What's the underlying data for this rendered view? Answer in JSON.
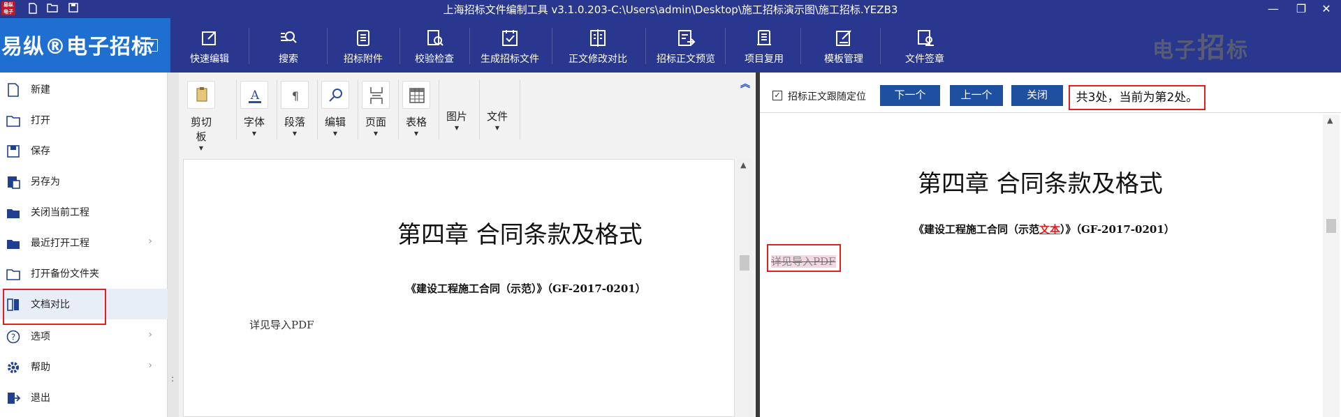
{
  "window": {
    "title": "上海招标文件编制工具 v3.1.0.203-C:\\Users\\admin\\Desktop\\施工招标演示图\\施工招标.YEZB3",
    "app_icon_text": "易纵 电子招标"
  },
  "brand": {
    "name": "易纵®电子招标"
  },
  "ribbon": {
    "tools": [
      {
        "label": "快速编辑",
        "icon": "quick-edit-icon"
      },
      {
        "label": "搜索",
        "icon": "search-icon"
      },
      {
        "label": "招标附件",
        "icon": "attachment-icon"
      },
      {
        "label": "校验检查",
        "icon": "check-icon"
      },
      {
        "label": "生成招标文件",
        "icon": "generate-file-icon"
      },
      {
        "label": "正文修改对比",
        "icon": "compare-icon"
      },
      {
        "label": "招标正文预览",
        "icon": "preview-icon"
      },
      {
        "label": "项目复用",
        "icon": "reuse-icon"
      },
      {
        "label": "模板管理",
        "icon": "template-icon"
      },
      {
        "label": "文件签章",
        "icon": "signature-icon"
      }
    ],
    "watermark_a": "电子",
    "watermark_b": "招",
    "watermark_c": "标"
  },
  "sidebar": {
    "items": [
      {
        "label": "新建",
        "icon": "new-file-icon"
      },
      {
        "label": "打开",
        "icon": "open-folder-icon"
      },
      {
        "label": "保存",
        "icon": "save-icon"
      },
      {
        "label": "另存为",
        "icon": "save-as-icon"
      },
      {
        "label": "关闭当前工程",
        "icon": "close-project-icon"
      },
      {
        "label": "最近打开工程",
        "icon": "recent-folder-icon",
        "arrow": "›"
      },
      {
        "label": "打开备份文件夹",
        "icon": "backup-folder-icon"
      },
      {
        "label": "文档对比",
        "icon": "doc-compare-icon"
      },
      {
        "label": "选项",
        "icon": "help-circle-icon",
        "arrow": "›"
      },
      {
        "label": "帮助",
        "icon": "gear-icon",
        "arrow": "›"
      },
      {
        "label": "退出",
        "icon": "exit-icon"
      }
    ]
  },
  "editor_toolbar": {
    "groups": [
      {
        "label": "剪切板"
      },
      {
        "label": "字体"
      },
      {
        "label": "段落"
      },
      {
        "label": "编辑"
      },
      {
        "label": "页面"
      },
      {
        "label": "表格"
      },
      {
        "label": "图片"
      },
      {
        "label": "文件"
      }
    ]
  },
  "left_doc": {
    "title": "第四章  合同条款及格式",
    "subtitle": "《建设工程施工合同（示范）》（GF-2017-0201）",
    "body": "详见导入PDF"
  },
  "compare_bar": {
    "checkbox_label": "招标正文跟随定位",
    "checked": true,
    "next_label": "下一个",
    "prev_label": "上一个",
    "close_label": "关闭",
    "counter_text": "共3处，当前为第2处。"
  },
  "right_doc": {
    "title": "第四章  合同条款及格式",
    "subtitle_pre": "《建设工程施工合同（示范",
    "subtitle_ins": "文本",
    "subtitle_post": "）》（GF-2017-0201）",
    "body_deleted": "详见导入PDF"
  },
  "colors": {
    "titlebar": "#29378e",
    "brand": "#1f6fd1",
    "highlight": "#e02020",
    "button": "#1f4f9f"
  }
}
